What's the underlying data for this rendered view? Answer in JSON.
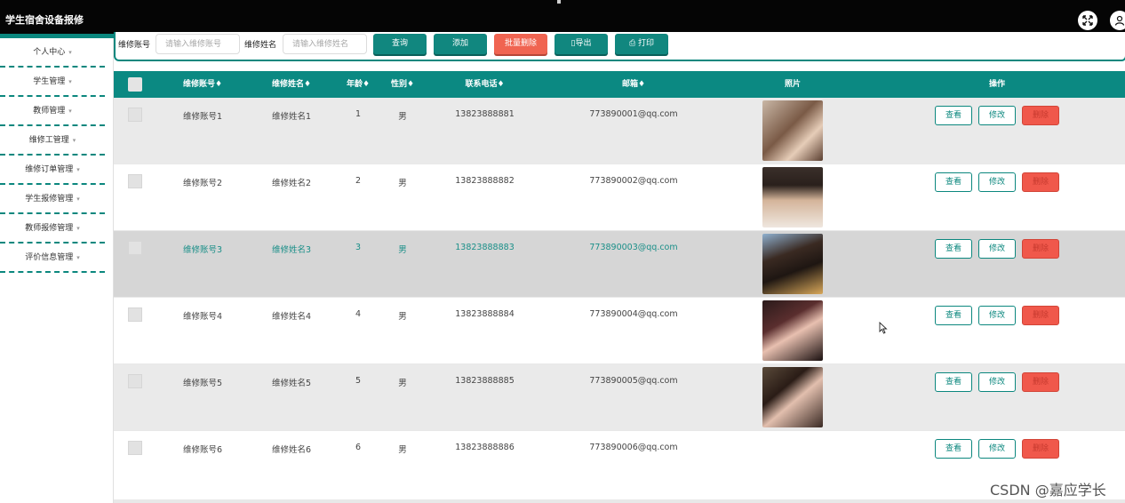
{
  "app": {
    "title": "学生宿舍设备报修",
    "fullscreen_icon": "expand-icon",
    "user_icon": "user-icon"
  },
  "sidebar": {
    "items": [
      {
        "label": "个人中心"
      },
      {
        "label": "学生管理"
      },
      {
        "label": "教师管理"
      },
      {
        "label": "维修工管理"
      },
      {
        "label": "维修订单管理"
      },
      {
        "label": "学生报修管理"
      },
      {
        "label": "教师报修管理"
      },
      {
        "label": "评价信息管理"
      }
    ],
    "caret": "▾"
  },
  "search": {
    "account_label": "维修账号",
    "account_placeholder": "请输入维修账号",
    "name_label": "维修姓名",
    "name_placeholder": "请输入维修姓名",
    "query_button": "查询",
    "add_button": "添加",
    "batch_delete_button": "批量删除",
    "export_button": "导出",
    "print_button": "打印"
  },
  "table": {
    "headers": {
      "account": "维修账号",
      "name": "维修姓名",
      "age": "年龄",
      "gender": "性别",
      "phone": "联系电话",
      "email": "邮箱",
      "photo": "照片",
      "actions": "操作"
    },
    "sort_marker": "♦",
    "rows": [
      {
        "account": "维修账号1",
        "name": "维修姓名1",
        "age": "1",
        "gender": "男",
        "phone": "13823888881",
        "email": "773890001@qq.com",
        "has_photo": true
      },
      {
        "account": "维修账号2",
        "name": "维修姓名2",
        "age": "2",
        "gender": "男",
        "phone": "13823888882",
        "email": "773890002@qq.com",
        "has_photo": true
      },
      {
        "account": "维修账号3",
        "name": "维修姓名3",
        "age": "3",
        "gender": "男",
        "phone": "13823888883",
        "email": "773890003@qq.com",
        "has_photo": true
      },
      {
        "account": "维修账号4",
        "name": "维修姓名4",
        "age": "4",
        "gender": "男",
        "phone": "13823888884",
        "email": "773890004@qq.com",
        "has_photo": true
      },
      {
        "account": "维修账号5",
        "name": "维修姓名5",
        "age": "5",
        "gender": "男",
        "phone": "13823888885",
        "email": "773890005@qq.com",
        "has_photo": true
      },
      {
        "account": "维修账号6",
        "name": "维修姓名6",
        "age": "6",
        "gender": "男",
        "phone": "13823888886",
        "email": "773890006@qq.com",
        "has_photo": false
      }
    ],
    "row_actions": {
      "view": "查看",
      "edit": "修改",
      "delete": "删除"
    }
  },
  "watermark": "CSDN @嘉应学长",
  "colors": {
    "accent": "#0b877e",
    "danger": "#f0584b",
    "topbar": "#050505"
  }
}
